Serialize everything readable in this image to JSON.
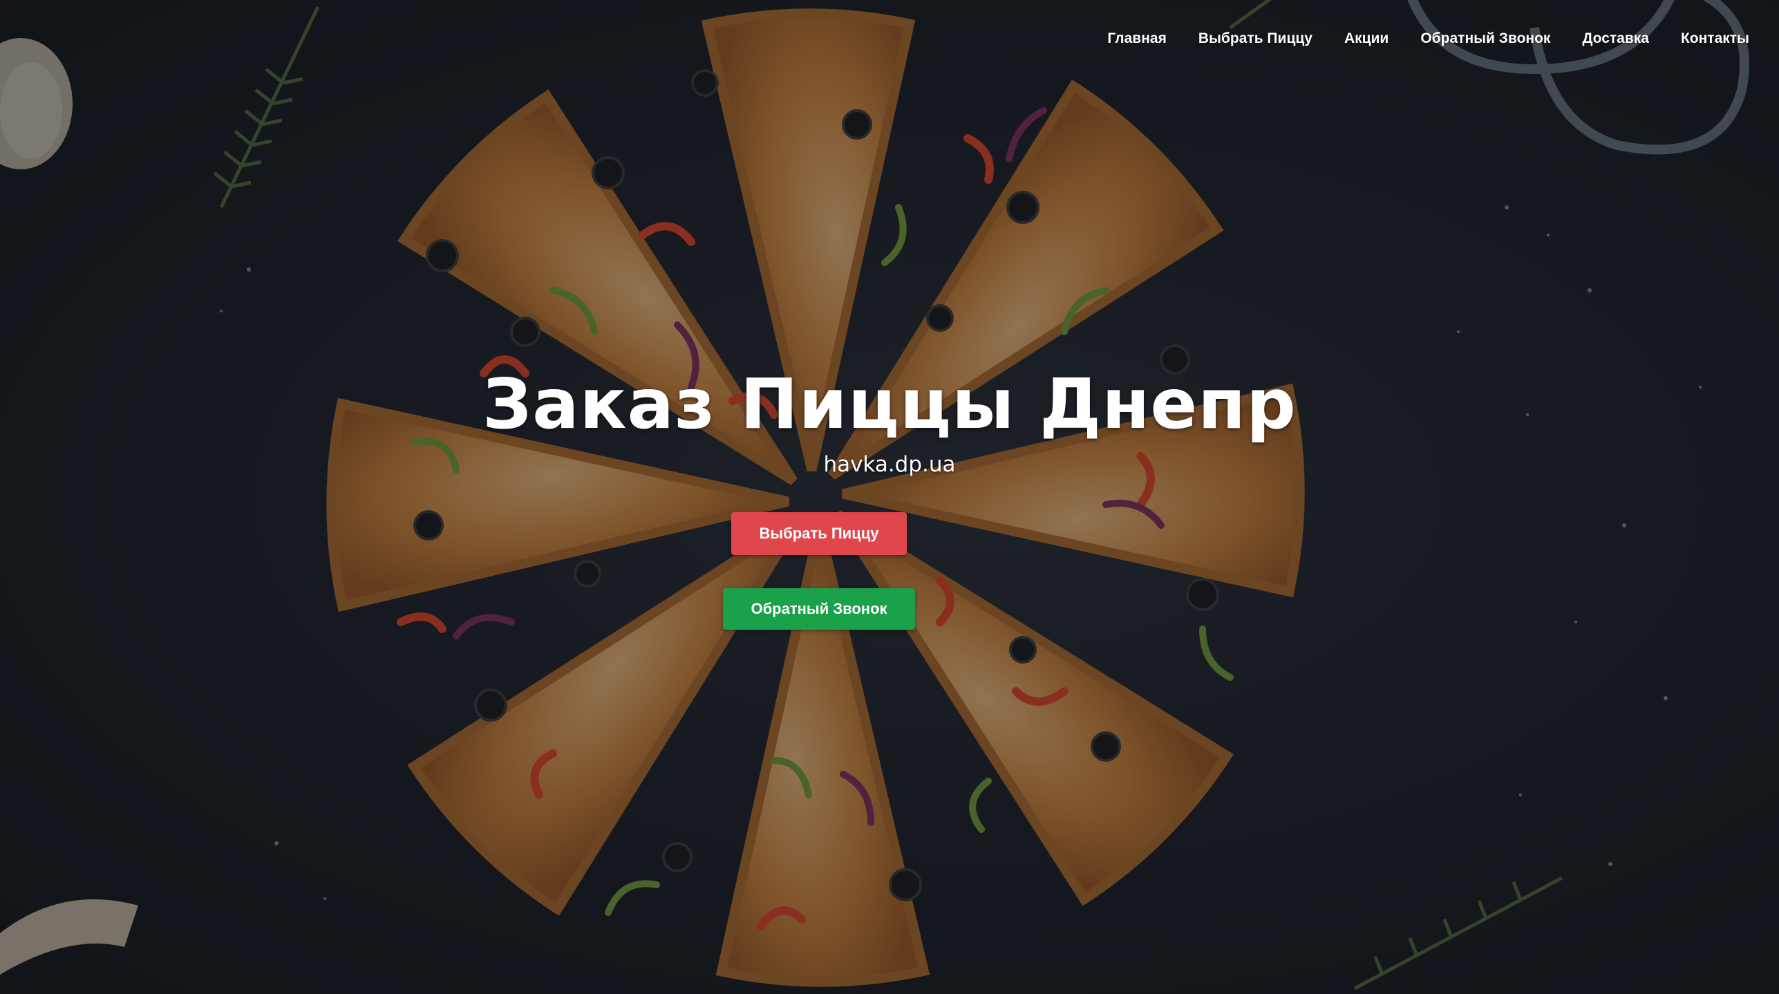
{
  "nav": {
    "items": [
      {
        "label": "Главная"
      },
      {
        "label": "Выбрать Пиццу"
      },
      {
        "label": "Акции"
      },
      {
        "label": "Обратный Звонок"
      },
      {
        "label": "Доставка"
      },
      {
        "label": "Контакты"
      }
    ]
  },
  "hero": {
    "title": "Заказ Пиццы Днепр",
    "subtitle": "havka.dp.ua",
    "choose_pizza_label": "Выбрать Пиццу",
    "callback_label": "Обратный Звонок"
  },
  "colors": {
    "choose_pizza_button": "#e0474c",
    "callback_button": "#1aa24a",
    "background": "#1c2028"
  },
  "background_image": "pizza-slices-on-dark-table"
}
